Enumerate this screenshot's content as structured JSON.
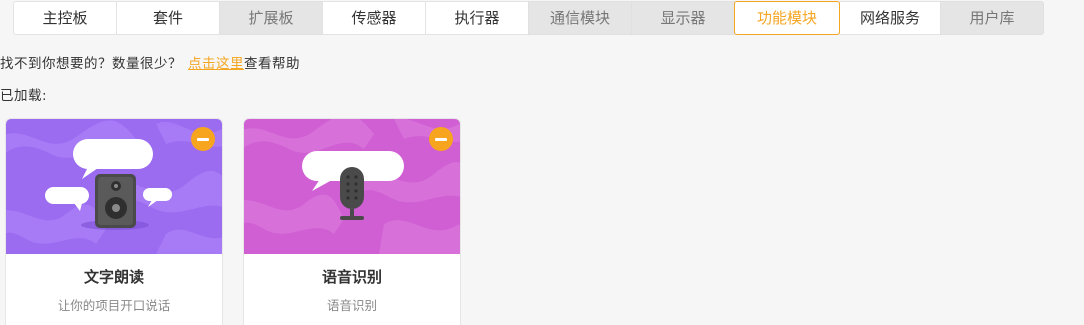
{
  "tabs": [
    {
      "label": "主控板",
      "state": "normal"
    },
    {
      "label": "套件",
      "state": "normal"
    },
    {
      "label": "扩展板",
      "state": "gray"
    },
    {
      "label": "传感器",
      "state": "normal"
    },
    {
      "label": "执行器",
      "state": "normal"
    },
    {
      "label": "通信模块",
      "state": "gray"
    },
    {
      "label": "显示器",
      "state": "gray"
    },
    {
      "label": "功能模块",
      "state": "active"
    },
    {
      "label": "网络服务",
      "state": "normal"
    },
    {
      "label": "用户库",
      "state": "gray"
    }
  ],
  "help": {
    "text": "找不到你想要的？数量很少？",
    "link": "点击这里",
    "suffix": "查看帮助"
  },
  "loaded_label": "已加载:",
  "cards": [
    {
      "title": "文字朗读",
      "desc": "让你的项目开口说话",
      "icon": "speaker-icon",
      "bg_color": "#9b6cf0"
    },
    {
      "title": "语音识别",
      "desc": "语音识别",
      "icon": "microphone-icon",
      "bg_color": "#cf5fd3"
    }
  ],
  "colors": {
    "accent": "#f5a623",
    "remove_button": "#f7a51f"
  }
}
